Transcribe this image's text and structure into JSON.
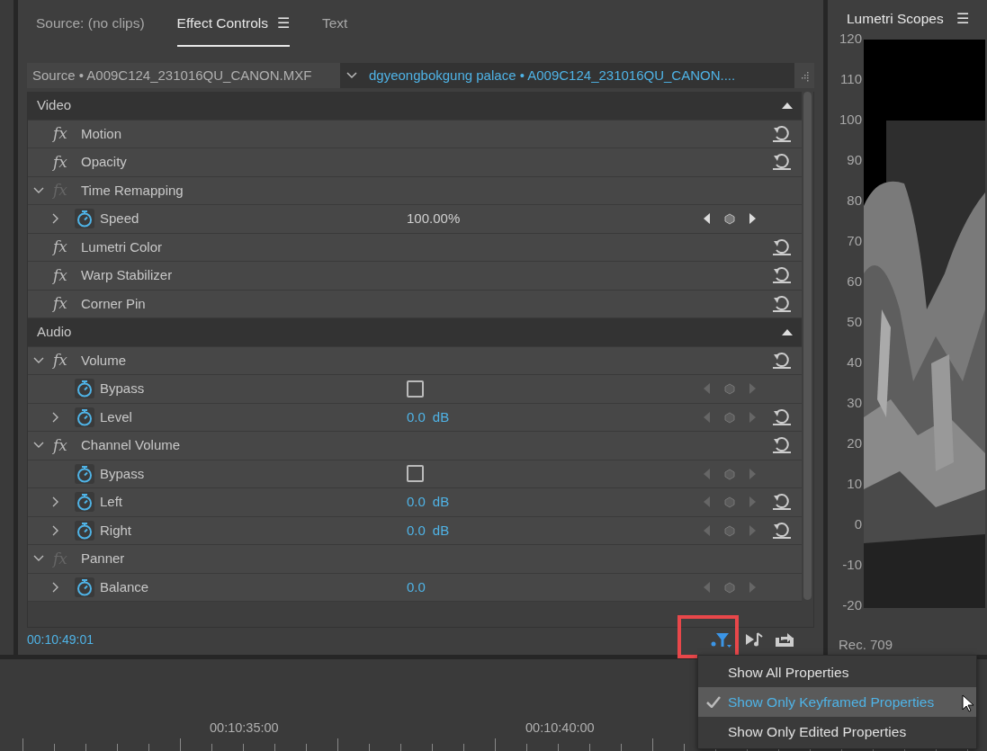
{
  "tabs": [
    {
      "label": "Source: (no clips)",
      "selected": false
    },
    {
      "label": "Effect Controls",
      "selected": true,
      "menu": "☰"
    },
    {
      "label": "Text",
      "selected": false
    }
  ],
  "header": {
    "source": "Source • A009C124_231016QU_CANON.MXF",
    "sequence": "dgyeongbokgung palace • A009C124_231016QU_CANON...."
  },
  "sections": [
    {
      "label": "Video",
      "expanded": true,
      "effects": [
        {
          "name": "Motion",
          "fx": "fx",
          "fx_enabled": true,
          "reset": true
        },
        {
          "name": "Opacity",
          "fx": "fx",
          "fx_enabled": true,
          "reset": true
        },
        {
          "name": "Time Remapping",
          "fx": "fx",
          "fx_enabled": false,
          "expanded": true,
          "reset": false,
          "children": [
            {
              "name": "Speed",
              "kind": "value",
              "expanded": false,
              "value": "100.00%",
              "hot": false,
              "keyframe_nav_active": true,
              "reset": false
            }
          ]
        },
        {
          "name": "Lumetri Color",
          "fx": "fx",
          "fx_enabled": true,
          "reset": true
        },
        {
          "name": "Warp Stabilizer",
          "fx": "fx",
          "fx_enabled": true,
          "reset": true
        },
        {
          "name": "Corner Pin",
          "fx": "fx",
          "fx_enabled": true,
          "reset": true
        }
      ]
    },
    {
      "label": "Audio",
      "expanded": true,
      "effects": [
        {
          "name": "Volume",
          "fx": "fx",
          "fx_enabled": true,
          "expanded": true,
          "reset": true,
          "children": [
            {
              "name": "Bypass",
              "kind": "checkbox",
              "checked": false,
              "keyframe_nav_active": false,
              "reset": false
            },
            {
              "name": "Level",
              "kind": "value",
              "expanded": false,
              "value": "0.0",
              "unit": "dB",
              "hot": true,
              "keyframe_nav_active": false,
              "reset": true
            }
          ]
        },
        {
          "name": "Channel Volume",
          "fx": "fx",
          "fx_enabled": true,
          "expanded": true,
          "reset": true,
          "children": [
            {
              "name": "Bypass",
              "kind": "checkbox",
              "checked": false,
              "keyframe_nav_active": false,
              "reset": false
            },
            {
              "name": "Left",
              "kind": "value",
              "expanded": false,
              "value": "0.0",
              "unit": "dB",
              "hot": true,
              "keyframe_nav_active": false,
              "reset": true
            },
            {
              "name": "Right",
              "kind": "value",
              "expanded": false,
              "value": "0.0",
              "unit": "dB",
              "hot": true,
              "keyframe_nav_active": false,
              "reset": true
            }
          ]
        },
        {
          "name": "Panner",
          "fx": "fx",
          "fx_enabled": false,
          "expanded": true,
          "reset": false,
          "children": [
            {
              "name": "Balance",
              "kind": "value",
              "expanded": false,
              "value": "0.0",
              "hot": true,
              "keyframe_nav_active": false,
              "reset": false
            }
          ]
        }
      ]
    }
  ],
  "footer": {
    "timecode": "00:10:49:01",
    "filter_highlighted": true
  },
  "scopes": {
    "title": "Lumetri Scopes",
    "menu": "☰",
    "scale": [
      "120",
      "110",
      "100",
      "90",
      "80",
      "70",
      "60",
      "50",
      "40",
      "30",
      "20",
      "10",
      "0",
      "-10",
      "-20"
    ],
    "standard": "Rec. 709"
  },
  "timeline": {
    "times": [
      "00:10:35:00",
      "00:10:40:00"
    ]
  },
  "menu": [
    {
      "label": "Show All Properties",
      "checked": false,
      "selected": false
    },
    {
      "label": "Show Only Keyframed Properties",
      "checked": true,
      "selected": true
    },
    {
      "label": "Show Only Edited Properties",
      "checked": false,
      "selected": false
    }
  ]
}
